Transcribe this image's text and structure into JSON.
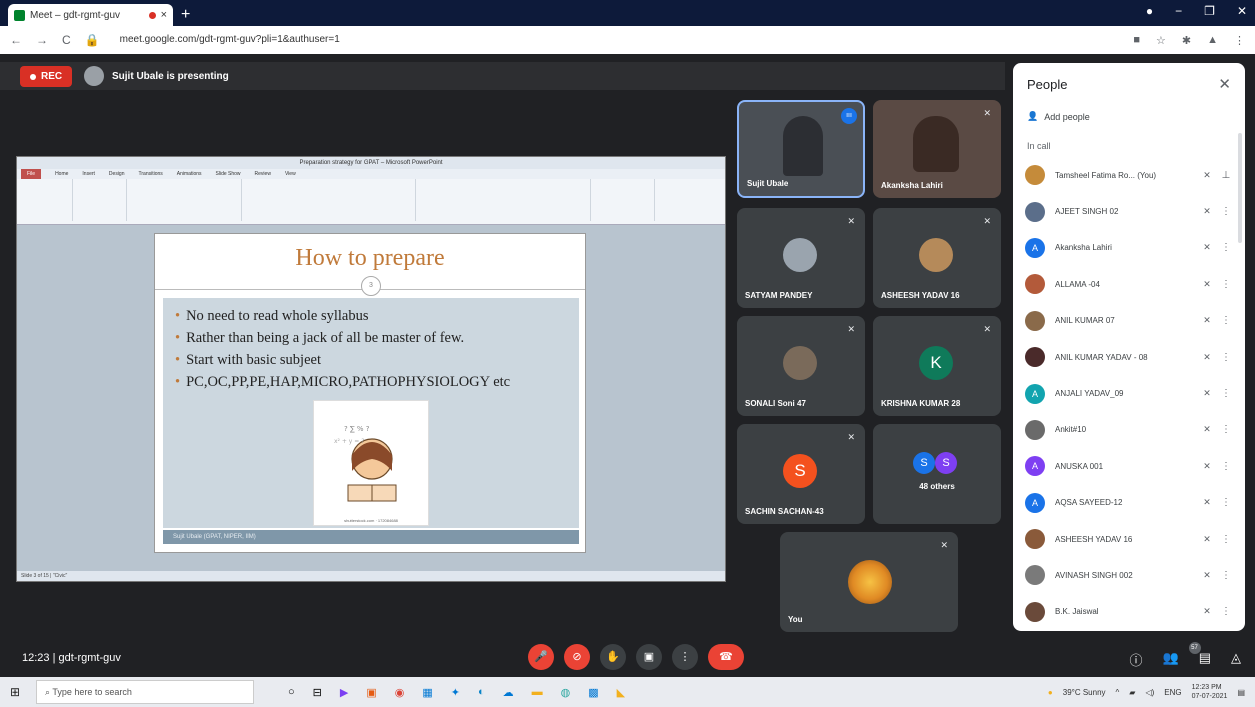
{
  "browser": {
    "tab_title": "Meet – gdt-rgmt-guv",
    "tab_close": "×",
    "new_tab": "+",
    "url": "meet.google.com/gdt-rgmt-guv?pli=1&authuser=1",
    "back": "←",
    "forward": "→",
    "reload": "C"
  },
  "meet": {
    "rec_label": "REC",
    "presenting_text": "Sujit Ubale is presenting",
    "meeting_time": "12:23",
    "meeting_code": "gdt-rgmt-guv"
  },
  "presentation": {
    "window_title": "Preparation strategy for GPAT – Microsoft PowerPoint",
    "ribbon_tabs": [
      "File",
      "Home",
      "Insert",
      "Design",
      "Transitions",
      "Animations",
      "Slide Show",
      "Review",
      "View"
    ],
    "slide_title": "How to prepare",
    "slide_number": "3",
    "bullets": [
      "No need to read whole syllabus",
      "Rather than being a jack of all be master of few.",
      "Start with basic subjeet",
      "PC,OC,PP,PE,HAP,MICRO,PATHOPHYSIOLOGY etc"
    ],
    "image_caption": "shutterstock.com · 172084688",
    "footer": "Sujit Ubale (GPAT, NIPER, IIM)",
    "status": "Slide 3 of 15 | \"Civic\""
  },
  "tiles": [
    {
      "name": "Sujit Ubale"
    },
    {
      "name": "Akanksha Lahiri"
    },
    {
      "name": "SATYAM PANDEY"
    },
    {
      "name": "ASHEESH YADAV 16"
    },
    {
      "name": "SONALI Soni 47"
    },
    {
      "name": "KRISHNA KUMAR 28",
      "letter": "K"
    },
    {
      "name": "SACHIN SACHAN-43",
      "letter": "S"
    },
    {
      "name": "48 others",
      "letter1": "S",
      "letter2": "S"
    },
    {
      "name": "You"
    }
  ],
  "people": {
    "title": "People",
    "add_people": "Add people",
    "in_call": "In call",
    "list": [
      {
        "name": "Tamsheel Fatima Ro... (You)",
        "letter": "",
        "color": "#c58b3a"
      },
      {
        "name": "AJEET SINGH 02",
        "letter": "",
        "color": "#5b6e8a"
      },
      {
        "name": "Akanksha Lahiri",
        "letter": "A",
        "color": "#1a73e8"
      },
      {
        "name": "ALLAMA -04",
        "letter": "",
        "color": "#b35a3a"
      },
      {
        "name": "ANIL KUMAR 07",
        "letter": "",
        "color": "#8a6a4a"
      },
      {
        "name": "ANIL KUMAR YADAV - 08",
        "letter": "",
        "color": "#4a2a2a"
      },
      {
        "name": "ANJALI YADAV_09",
        "letter": "A",
        "color": "#12a4af"
      },
      {
        "name": "Ankit#10",
        "letter": "",
        "color": "#6a6a6a"
      },
      {
        "name": "ANUSKA 001",
        "letter": "A",
        "color": "#7e3ff2"
      },
      {
        "name": "AQSA SAYEED-12",
        "letter": "A",
        "color": "#1a73e8"
      },
      {
        "name": "ASHEESH YADAV 16",
        "letter": "",
        "color": "#8a5a3a"
      },
      {
        "name": "AVINASH SINGH 002",
        "letter": "",
        "color": "#7a7a7a"
      },
      {
        "name": "B.K. Jaiswal",
        "letter": "",
        "color": "#6a4a3a"
      }
    ]
  },
  "bottom": {
    "people_count": "57"
  },
  "taskbar": {
    "search_placeholder": "Type here to search",
    "weather": "39°C Sunny",
    "lang": "ENG",
    "time": "12:23 PM",
    "date": "07-07-2021"
  }
}
